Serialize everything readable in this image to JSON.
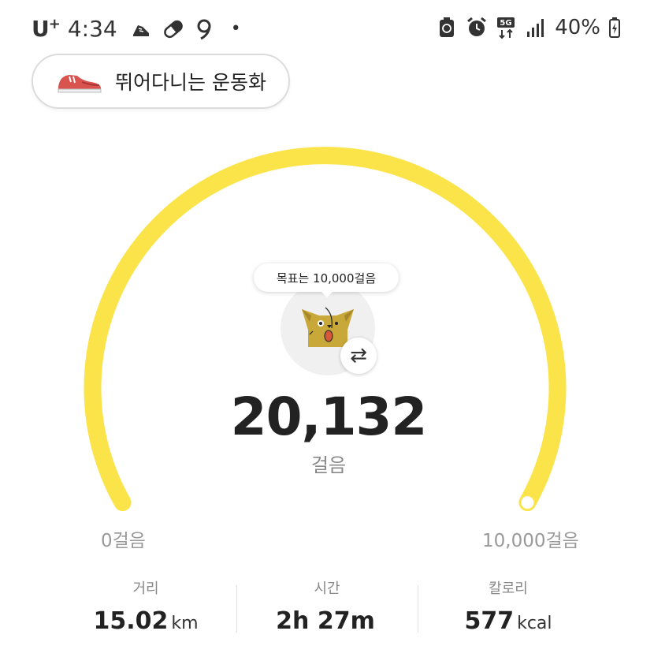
{
  "status_bar": {
    "carrier": "U",
    "carrier_sup": "+",
    "time": "4:34",
    "battery": "40%",
    "network": "5G",
    "left_icons": [
      "shoe-icon",
      "pill-icon",
      "nine-icon"
    ],
    "right_icons": [
      "battery-saver-icon",
      "alarm-icon",
      "network-5g-icon",
      "signal-icon",
      "battery-icon"
    ]
  },
  "shoe": {
    "name": "뛰어다니는 운동화"
  },
  "gauge": {
    "goal_text": "목표는 10,000걸음",
    "steps": "20,132",
    "unit": "걸음",
    "min_label": "0걸음",
    "max_label": "10,000걸음",
    "color": "#fbe34a",
    "progress": 1.0
  },
  "stats": [
    {
      "label": "거리",
      "value": "15.02",
      "unit": "km"
    },
    {
      "label": "시간",
      "value": "2h 27m",
      "unit": ""
    },
    {
      "label": "칼로리",
      "value": "577",
      "unit": "kcal"
    }
  ]
}
